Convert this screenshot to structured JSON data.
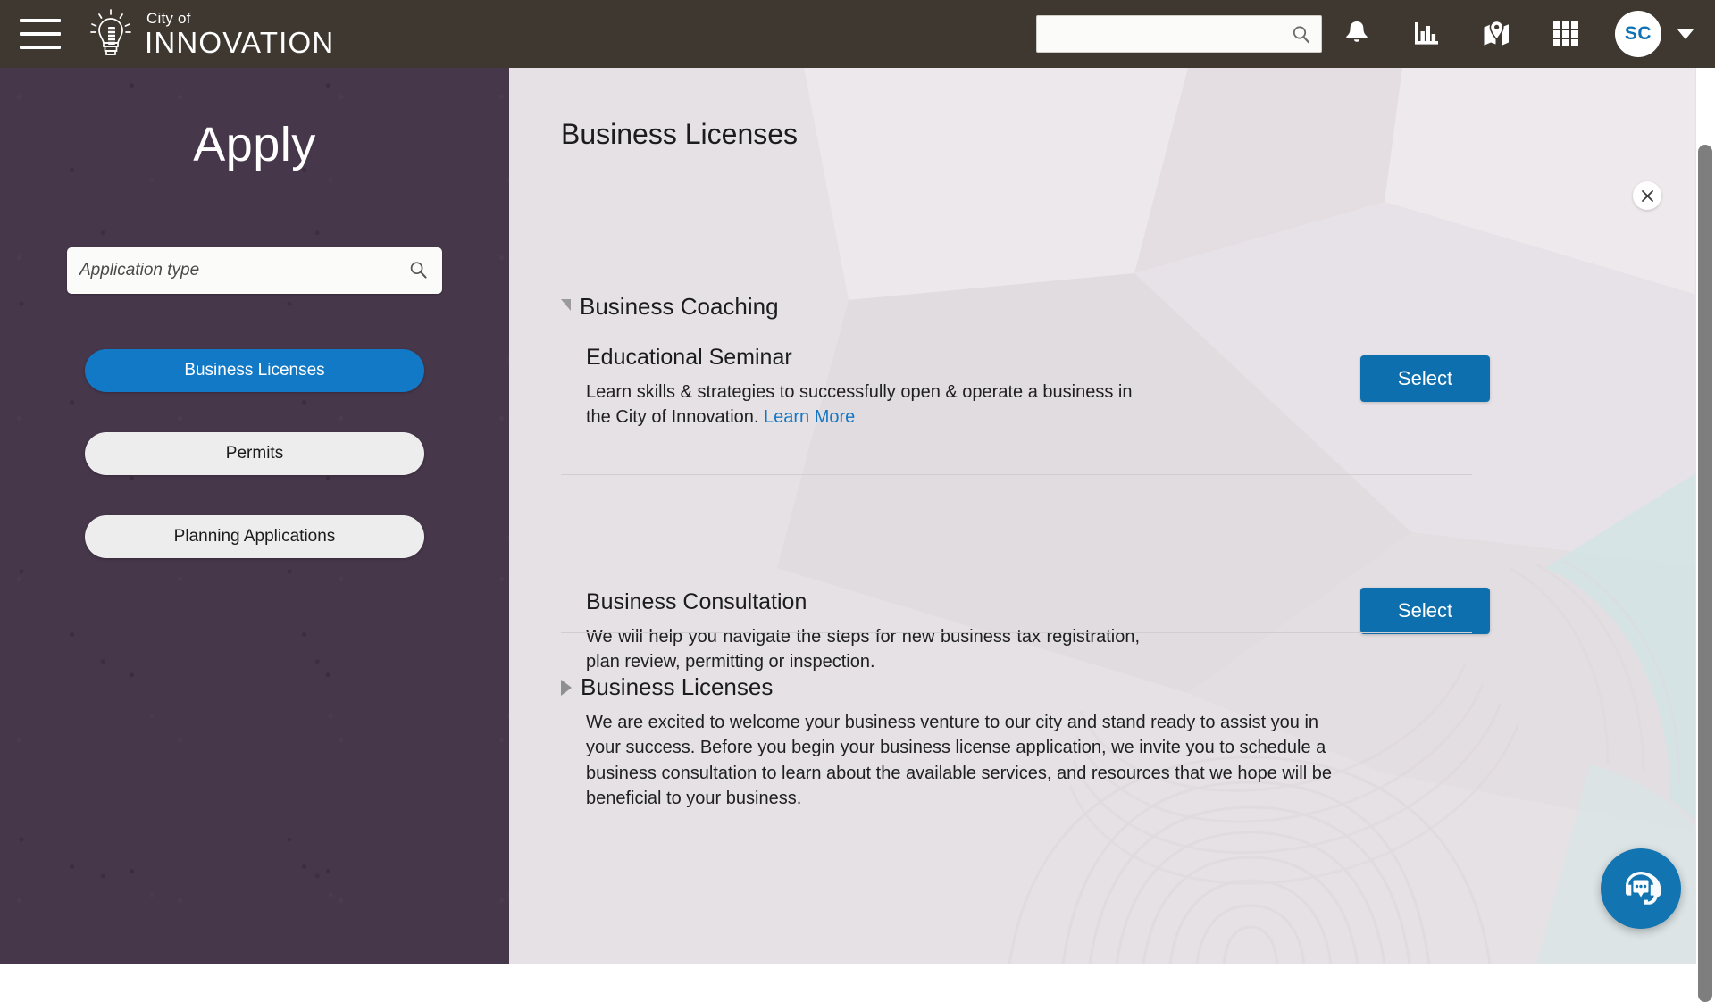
{
  "topbar": {
    "menu_label": "menu",
    "brand_small": "City of",
    "brand_big": "INNOVATION",
    "search_value": "",
    "search_placeholder": "",
    "icons": [
      "search-icon",
      "bell-icon",
      "bar-chart-icon",
      "map-pin-icon",
      "apps-grid-icon"
    ],
    "avatar_initials": "SC",
    "background_color": "#3E3830"
  },
  "sidebar": {
    "title": "Apply",
    "background_color": "#47374B",
    "search": {
      "value": "",
      "placeholder": "Application type",
      "icon": "search-icon"
    },
    "items": [
      {
        "label": "Business Licenses",
        "active": true,
        "color": "#1279C6"
      },
      {
        "label": "Permits",
        "active": false,
        "color": "#EDEDED"
      },
      {
        "label": "Planning Applications",
        "active": false,
        "color": "#EDEDED"
      }
    ]
  },
  "main": {
    "title": "Business Licenses",
    "close_label": "×",
    "background_color": "#E5E1E4",
    "accent_color": "#0D6FAD",
    "link_color": "#1577C4",
    "groups": [
      {
        "name": "Business Coaching",
        "expanded": true,
        "items": [
          {
            "title": "Educational Seminar",
            "description": "Learn skills & strategies to successfully open & operate a business in the City of Innovation. ",
            "link_text": "Learn More",
            "button_label": "Select"
          },
          {
            "title": "Business Consultation",
            "description": "We will help you navigate the steps for new business tax registration, plan review, permitting or inspection.",
            "link_text": "",
            "button_label": "Select"
          }
        ]
      },
      {
        "name": "Business Licenses",
        "expanded": false,
        "description": "We are excited to welcome your business venture to our city and stand ready to assist you in your success. Before you begin your business license application, we invite you to schedule a business consultation to learn about the available services, and resources that we hope will be beneficial to your business."
      }
    ]
  },
  "chat": {
    "icon": "headset-chat-icon",
    "color": "#1274B0"
  },
  "scrollbar": {
    "thumb_color": "#7e7e7e"
  }
}
